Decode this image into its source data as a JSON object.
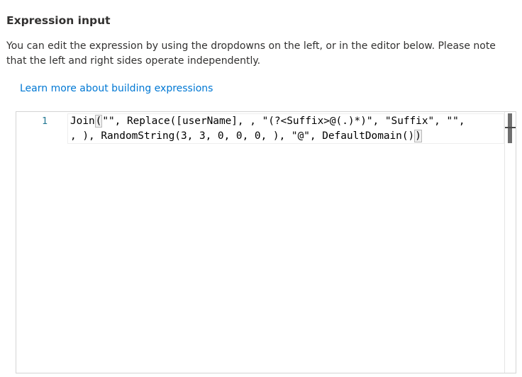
{
  "section": {
    "title": "Expression input",
    "description": "You can edit the expression by using the dropdowns on the left, or in the editor below. Please note that the left and right sides operate independently.",
    "learn_more_link": "Learn more about building expressions"
  },
  "editor": {
    "line_number": "1",
    "line1_before_bracket": "Join",
    "line1_open_bracket": "(",
    "line1_after_bracket": "\"\", Replace([userName], , \"(?<Suffix>@(.)*)\", \"Suffix\", \"\",",
    "line2_before_bracket": ", ), RandomString(3, 3, 0, 0, 0, ), \"@\", DefaultDomain()",
    "line2_close_bracket": ")"
  },
  "colors": {
    "link": "#0078d4",
    "line_number": "#237893",
    "text": "#323130"
  }
}
